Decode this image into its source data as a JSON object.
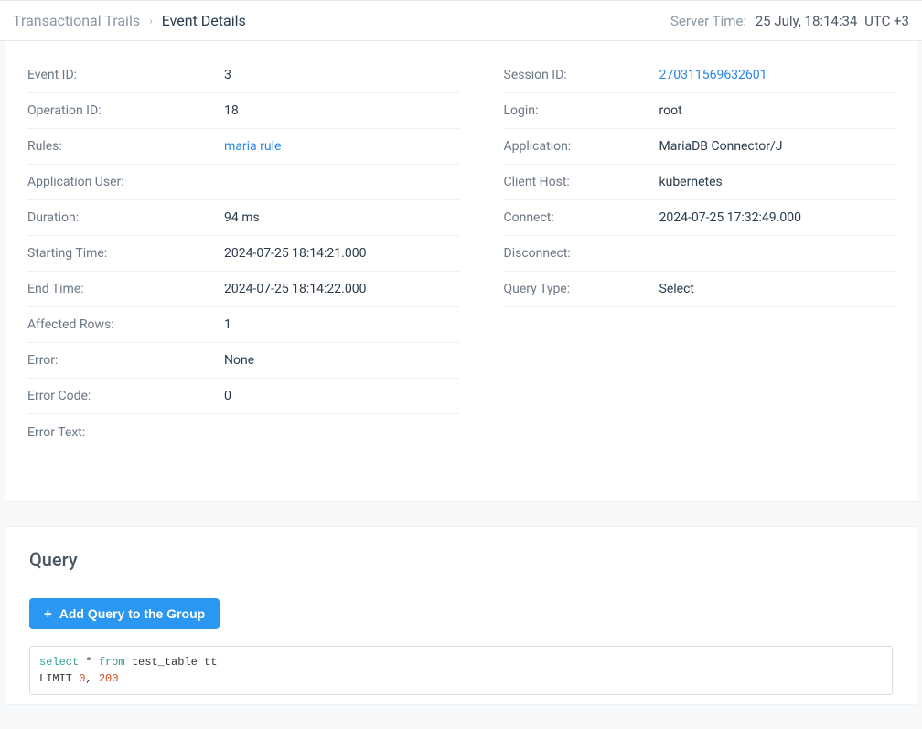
{
  "breadcrumb": {
    "parent": "Transactional Trails",
    "current": "Event Details"
  },
  "server_time": {
    "label": "Server Time:",
    "value": "25 July, 18:14:34",
    "tz": "UTC +3"
  },
  "details_left": {
    "event_id": {
      "label": "Event ID:",
      "value": "3"
    },
    "operation_id": {
      "label": "Operation ID:",
      "value": "18"
    },
    "rules": {
      "label": "Rules:",
      "value": "maria rule"
    },
    "app_user": {
      "label": "Application User:",
      "value": ""
    },
    "duration": {
      "label": "Duration:",
      "value": "94 ms"
    },
    "start_time": {
      "label": "Starting Time:",
      "value": "2024-07-25 18:14:21.000"
    },
    "end_time": {
      "label": "End Time:",
      "value": "2024-07-25 18:14:22.000"
    },
    "affected_rows": {
      "label": "Affected Rows:",
      "value": "1"
    },
    "error": {
      "label": "Error:",
      "value": "None"
    },
    "error_code": {
      "label": "Error Code:",
      "value": "0"
    },
    "error_text": {
      "label": "Error Text:",
      "value": ""
    }
  },
  "details_right": {
    "session_id": {
      "label": "Session ID:",
      "value": "270311569632601"
    },
    "login": {
      "label": "Login:",
      "value": "root"
    },
    "application": {
      "label": "Application:",
      "value": "MariaDB Connector/J"
    },
    "client_host": {
      "label": "Client Host:",
      "value": "kubernetes"
    },
    "connect": {
      "label": "Connect:",
      "value": "2024-07-25 17:32:49.000"
    },
    "disconnect": {
      "label": "Disconnect:",
      "value": ""
    },
    "query_type": {
      "label": "Query Type:",
      "value": "Select"
    }
  },
  "query_section": {
    "title": "Query",
    "add_button": "Add Query to the Group",
    "sql": {
      "select_kw": "select",
      "star": "*",
      "from_kw": "from",
      "table": "test_table tt",
      "limit_kw": "LIMIT",
      "num1": "0",
      "comma": ",",
      "num2": "200"
    }
  }
}
